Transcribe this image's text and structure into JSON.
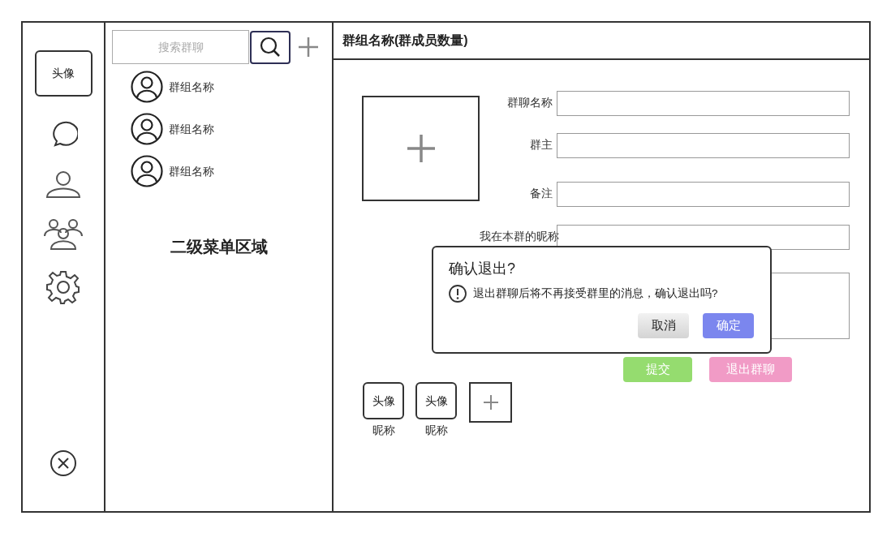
{
  "nav": {
    "avatar": "头像"
  },
  "group_list": {
    "search": {
      "placeholder": "搜索群聊"
    },
    "groups": [
      "群组名称",
      "群组名称",
      "群组名称"
    ],
    "area_label": "二级菜单区域"
  },
  "header": {
    "title": "群组名称(群成员数量)"
  },
  "form": {
    "fields": [
      {
        "kind": "input",
        "label": "群聊名称"
      },
      {
        "kind": "input",
        "label": "群主"
      },
      {
        "kind": "input",
        "label": "备注"
      },
      {
        "kind": "input",
        "label": "我在本群的昵称"
      },
      {
        "kind": "textarea"
      }
    ],
    "buttons": [
      {
        "kind": "submit",
        "label": "提交"
      },
      {
        "kind": "exit",
        "label": "退出群聊"
      }
    ]
  },
  "members": [
    {
      "avatar": "头像",
      "nickname": "昵称"
    },
    {
      "avatar": "头像",
      "nickname": "昵称"
    }
  ],
  "dialog": {
    "title": "确认退出?",
    "message": "退出群聊后将不再接受群里的消息，确认退出吗?",
    "buttons": [
      {
        "kind": "cancel",
        "label": "取消"
      },
      {
        "kind": "confirm",
        "label": "确定"
      }
    ]
  }
}
